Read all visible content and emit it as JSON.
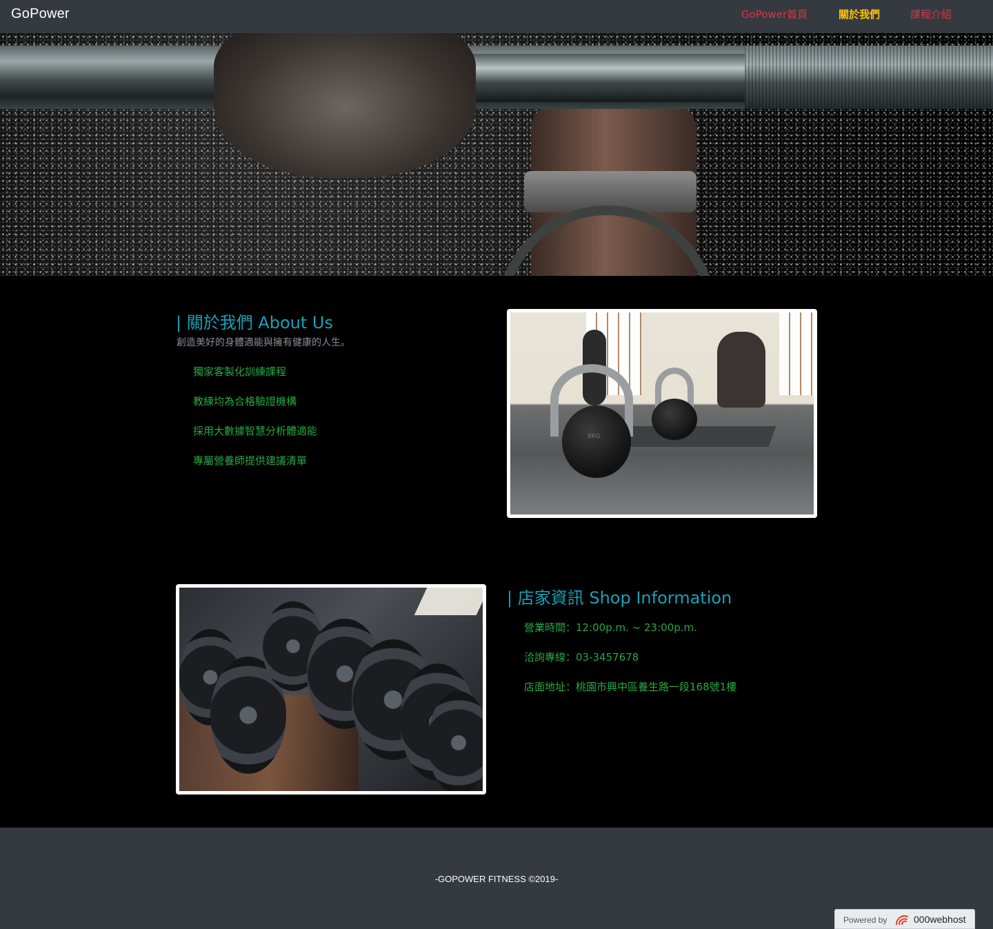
{
  "navbar": {
    "brand": "GoPower",
    "links": [
      "GoPower首頁",
      "關於我們",
      "課程介紹"
    ]
  },
  "about": {
    "title": "| 關於我們 About Us",
    "subtitle": "創造美好的身體適能與擁有健康的人生。",
    "features": [
      "獨家客製化訓練課程",
      "教練均為合格驗證機構",
      "採用大數據智慧分析體適能",
      "專屬營養師提供建議清單"
    ]
  },
  "shop": {
    "title": "| 店家資訊 Shop Information",
    "items": [
      "營業時間：12:00p.m. ~ 23:00p.m.",
      "洽詢專線：03-3457678",
      "店面地址：桃園市興中區養生路一段168號1樓"
    ]
  },
  "kettlebell_label": "8KG",
  "footer": {
    "copyright": "-GOPOWER FITNESS ©2019-"
  },
  "badge": {
    "powered_by": "Powered by",
    "host": "000webhost"
  },
  "colors": {
    "navbar": "#343a40",
    "accent_red": "#dc3545",
    "accent_yellow": "#ffc107",
    "title_teal": "#17a2b8",
    "text_green": "#28a745"
  }
}
